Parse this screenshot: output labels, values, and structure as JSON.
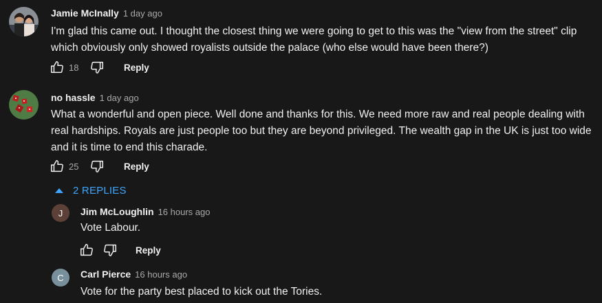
{
  "comments": [
    {
      "author": "Jamie McInally",
      "time": "1 day ago",
      "text": "I'm glad this came out. I thought the closest thing we were going to get to this was the \"view from the street\" clip which obviously only showed royalists outside the palace (who else would have been there?)",
      "likes": "18",
      "reply_label": "Reply",
      "avatar": "photo-couple"
    },
    {
      "author": "no hassle",
      "time": "1 day ago",
      "text": "What a wonderful and open piece. Well done and thanks for this. We need more raw and real people dealing with real hardships. Royals are just people too but they are beyond privileged. The wealth gap in the UK is just too wide and it is time to end this charade.",
      "likes": "25",
      "reply_label": "Reply",
      "avatar": "photo-dice"
    }
  ],
  "replies_toggle": {
    "label": "2 REPLIES",
    "icon": "caret-up-icon",
    "color": "#3ea6ff"
  },
  "replies": [
    {
      "author": "Jim McLoughlin",
      "time": "16 hours ago",
      "text": "Vote Labour.",
      "initial": "J",
      "avatar_color": "#5d4037",
      "reply_label": "Reply"
    },
    {
      "author": "Carl Pierce",
      "time": "16 hours ago",
      "text": "Vote for the party best placed to kick out the Tories.",
      "initial": "C",
      "avatar_color": "#78909c"
    }
  ]
}
